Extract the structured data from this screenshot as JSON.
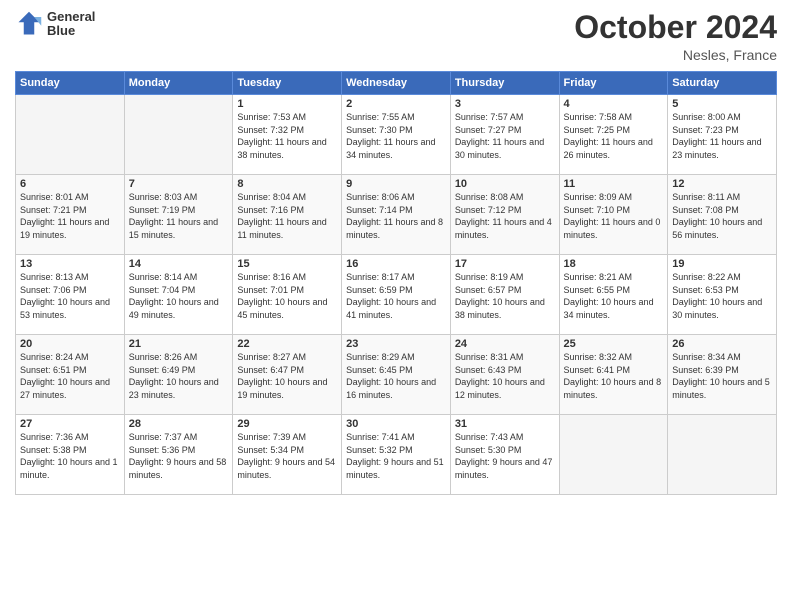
{
  "header": {
    "logo_line1": "General",
    "logo_line2": "Blue",
    "month": "October 2024",
    "location": "Nesles, France"
  },
  "weekdays": [
    "Sunday",
    "Monday",
    "Tuesday",
    "Wednesday",
    "Thursday",
    "Friday",
    "Saturday"
  ],
  "weeks": [
    [
      {
        "day": "",
        "info": ""
      },
      {
        "day": "",
        "info": ""
      },
      {
        "day": "1",
        "info": "Sunrise: 7:53 AM\nSunset: 7:32 PM\nDaylight: 11 hours and 38 minutes."
      },
      {
        "day": "2",
        "info": "Sunrise: 7:55 AM\nSunset: 7:30 PM\nDaylight: 11 hours and 34 minutes."
      },
      {
        "day": "3",
        "info": "Sunrise: 7:57 AM\nSunset: 7:27 PM\nDaylight: 11 hours and 30 minutes."
      },
      {
        "day": "4",
        "info": "Sunrise: 7:58 AM\nSunset: 7:25 PM\nDaylight: 11 hours and 26 minutes."
      },
      {
        "day": "5",
        "info": "Sunrise: 8:00 AM\nSunset: 7:23 PM\nDaylight: 11 hours and 23 minutes."
      }
    ],
    [
      {
        "day": "6",
        "info": "Sunrise: 8:01 AM\nSunset: 7:21 PM\nDaylight: 11 hours and 19 minutes."
      },
      {
        "day": "7",
        "info": "Sunrise: 8:03 AM\nSunset: 7:19 PM\nDaylight: 11 hours and 15 minutes."
      },
      {
        "day": "8",
        "info": "Sunrise: 8:04 AM\nSunset: 7:16 PM\nDaylight: 11 hours and 11 minutes."
      },
      {
        "day": "9",
        "info": "Sunrise: 8:06 AM\nSunset: 7:14 PM\nDaylight: 11 hours and 8 minutes."
      },
      {
        "day": "10",
        "info": "Sunrise: 8:08 AM\nSunset: 7:12 PM\nDaylight: 11 hours and 4 minutes."
      },
      {
        "day": "11",
        "info": "Sunrise: 8:09 AM\nSunset: 7:10 PM\nDaylight: 11 hours and 0 minutes."
      },
      {
        "day": "12",
        "info": "Sunrise: 8:11 AM\nSunset: 7:08 PM\nDaylight: 10 hours and 56 minutes."
      }
    ],
    [
      {
        "day": "13",
        "info": "Sunrise: 8:13 AM\nSunset: 7:06 PM\nDaylight: 10 hours and 53 minutes."
      },
      {
        "day": "14",
        "info": "Sunrise: 8:14 AM\nSunset: 7:04 PM\nDaylight: 10 hours and 49 minutes."
      },
      {
        "day": "15",
        "info": "Sunrise: 8:16 AM\nSunset: 7:01 PM\nDaylight: 10 hours and 45 minutes."
      },
      {
        "day": "16",
        "info": "Sunrise: 8:17 AM\nSunset: 6:59 PM\nDaylight: 10 hours and 41 minutes."
      },
      {
        "day": "17",
        "info": "Sunrise: 8:19 AM\nSunset: 6:57 PM\nDaylight: 10 hours and 38 minutes."
      },
      {
        "day": "18",
        "info": "Sunrise: 8:21 AM\nSunset: 6:55 PM\nDaylight: 10 hours and 34 minutes."
      },
      {
        "day": "19",
        "info": "Sunrise: 8:22 AM\nSunset: 6:53 PM\nDaylight: 10 hours and 30 minutes."
      }
    ],
    [
      {
        "day": "20",
        "info": "Sunrise: 8:24 AM\nSunset: 6:51 PM\nDaylight: 10 hours and 27 minutes."
      },
      {
        "day": "21",
        "info": "Sunrise: 8:26 AM\nSunset: 6:49 PM\nDaylight: 10 hours and 23 minutes."
      },
      {
        "day": "22",
        "info": "Sunrise: 8:27 AM\nSunset: 6:47 PM\nDaylight: 10 hours and 19 minutes."
      },
      {
        "day": "23",
        "info": "Sunrise: 8:29 AM\nSunset: 6:45 PM\nDaylight: 10 hours and 16 minutes."
      },
      {
        "day": "24",
        "info": "Sunrise: 8:31 AM\nSunset: 6:43 PM\nDaylight: 10 hours and 12 minutes."
      },
      {
        "day": "25",
        "info": "Sunrise: 8:32 AM\nSunset: 6:41 PM\nDaylight: 10 hours and 8 minutes."
      },
      {
        "day": "26",
        "info": "Sunrise: 8:34 AM\nSunset: 6:39 PM\nDaylight: 10 hours and 5 minutes."
      }
    ],
    [
      {
        "day": "27",
        "info": "Sunrise: 7:36 AM\nSunset: 5:38 PM\nDaylight: 10 hours and 1 minute."
      },
      {
        "day": "28",
        "info": "Sunrise: 7:37 AM\nSunset: 5:36 PM\nDaylight: 9 hours and 58 minutes."
      },
      {
        "day": "29",
        "info": "Sunrise: 7:39 AM\nSunset: 5:34 PM\nDaylight: 9 hours and 54 minutes."
      },
      {
        "day": "30",
        "info": "Sunrise: 7:41 AM\nSunset: 5:32 PM\nDaylight: 9 hours and 51 minutes."
      },
      {
        "day": "31",
        "info": "Sunrise: 7:43 AM\nSunset: 5:30 PM\nDaylight: 9 hours and 47 minutes."
      },
      {
        "day": "",
        "info": ""
      },
      {
        "day": "",
        "info": ""
      }
    ]
  ]
}
